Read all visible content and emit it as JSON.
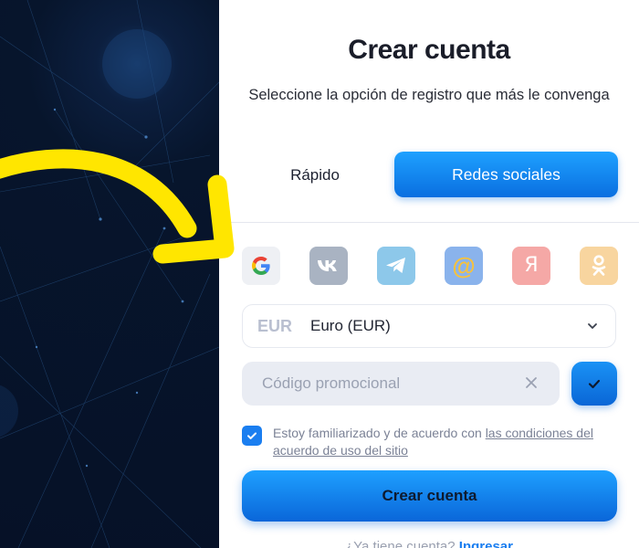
{
  "header": {
    "title": "Crear cuenta",
    "subtitle": "Seleccione la opción de registro que más le convenga"
  },
  "tabs": {
    "quick": "Rápido",
    "social": "Redes sociales",
    "active": "social"
  },
  "social_buttons": [
    {
      "name": "google",
      "icon": "google-icon",
      "color": "#eef0f4"
    },
    {
      "name": "vk",
      "icon": "vk-icon",
      "color": "#a9b3c2"
    },
    {
      "name": "telegram",
      "icon": "telegram-icon",
      "color": "#8dc8ea"
    },
    {
      "name": "mail",
      "icon": "at-sign-icon",
      "color": "#8ab3ec"
    },
    {
      "name": "yandex",
      "icon": "yandex-icon",
      "color": "#f5a8a6"
    },
    {
      "name": "odnoklassniki",
      "icon": "ok-icon",
      "color": "#f8d59f"
    }
  ],
  "currency": {
    "code": "EUR",
    "name": "Euro (EUR)"
  },
  "promo": {
    "placeholder": "Código promocional",
    "value": ""
  },
  "agreement": {
    "checked": true,
    "text": "Estoy familiarizado y de acuerdo con ",
    "link": "las condiciones del acuerdo de uso del sitio"
  },
  "submit_label": "Crear cuenta",
  "login": {
    "prompt": "¿Ya tiene cuenta?",
    "link": "Ingresar"
  },
  "colors": {
    "accent": "#1a7ef0",
    "dark_panel": "#07152c",
    "arrow": "#ffe600"
  }
}
